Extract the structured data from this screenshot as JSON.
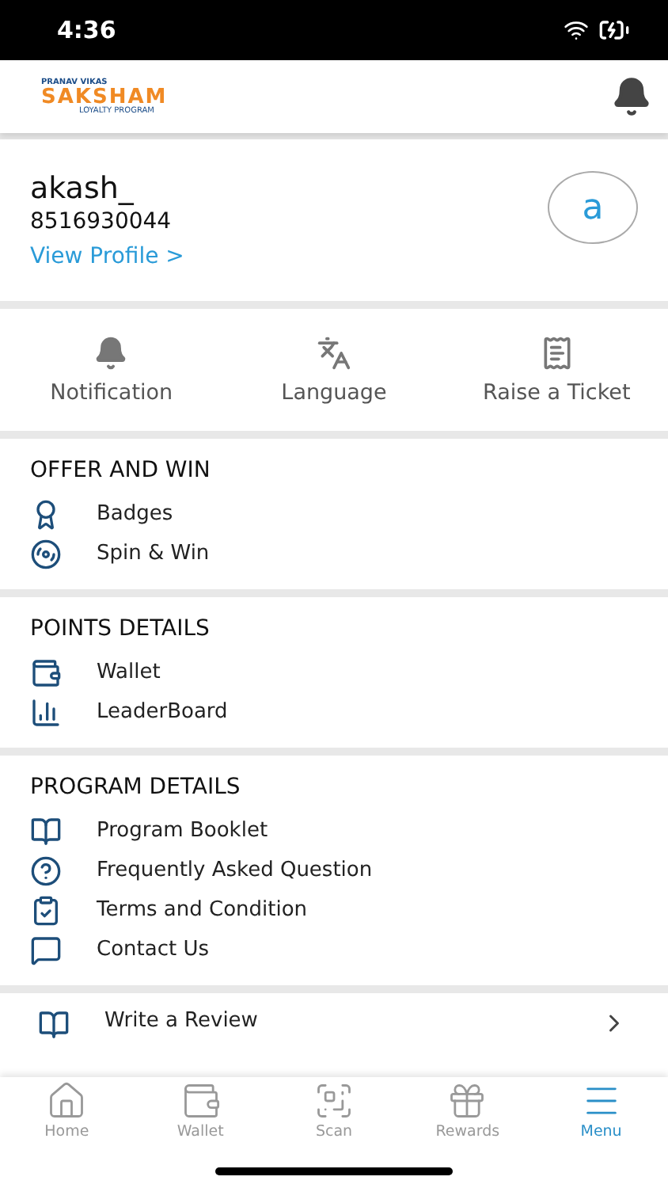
{
  "status_bar": {
    "time": "4:36"
  },
  "header": {
    "logo": {
      "top": "PRANAV VIKAS",
      "name": "SAKSHAM",
      "bottom": "LOYALTY PROGRAM"
    }
  },
  "profile": {
    "name": "akash_",
    "phone": "8516930044",
    "link": "View Profile >",
    "avatar": "a"
  },
  "quick_actions": [
    {
      "kind": "bell",
      "label": "Notification"
    },
    {
      "kind": "language",
      "label": "Language"
    },
    {
      "kind": "ticket",
      "label": "Raise a Ticket"
    }
  ],
  "sections": [
    {
      "title": "OFFER AND WIN",
      "items": [
        {
          "kind": "badge",
          "label": "Badges"
        },
        {
          "kind": "spin",
          "label": "Spin & Win"
        }
      ]
    },
    {
      "title": "POINTS DETAILS",
      "items": [
        {
          "kind": "wallet",
          "label": "Wallet"
        },
        {
          "kind": "leaderboard",
          "label": "LeaderBoard"
        }
      ]
    },
    {
      "title": "PROGRAM DETAILS",
      "items": [
        {
          "kind": "booklet",
          "label": "Program Booklet"
        },
        {
          "kind": "faq",
          "label": "Frequently Asked Question"
        },
        {
          "kind": "terms",
          "label": "Terms and Condition"
        },
        {
          "kind": "contact",
          "label": "Contact Us"
        }
      ]
    }
  ],
  "review_row": {
    "label": "Write a Review"
  },
  "tab_bar": [
    {
      "kind": "home",
      "label": "Home",
      "selected": false
    },
    {
      "kind": "wallet",
      "label": "Wallet",
      "selected": false
    },
    {
      "kind": "scan",
      "label": "Scan",
      "selected": false
    },
    {
      "kind": "rewards",
      "label": "Rewards",
      "selected": false
    },
    {
      "kind": "menu",
      "label": "Menu",
      "selected": true
    }
  ]
}
